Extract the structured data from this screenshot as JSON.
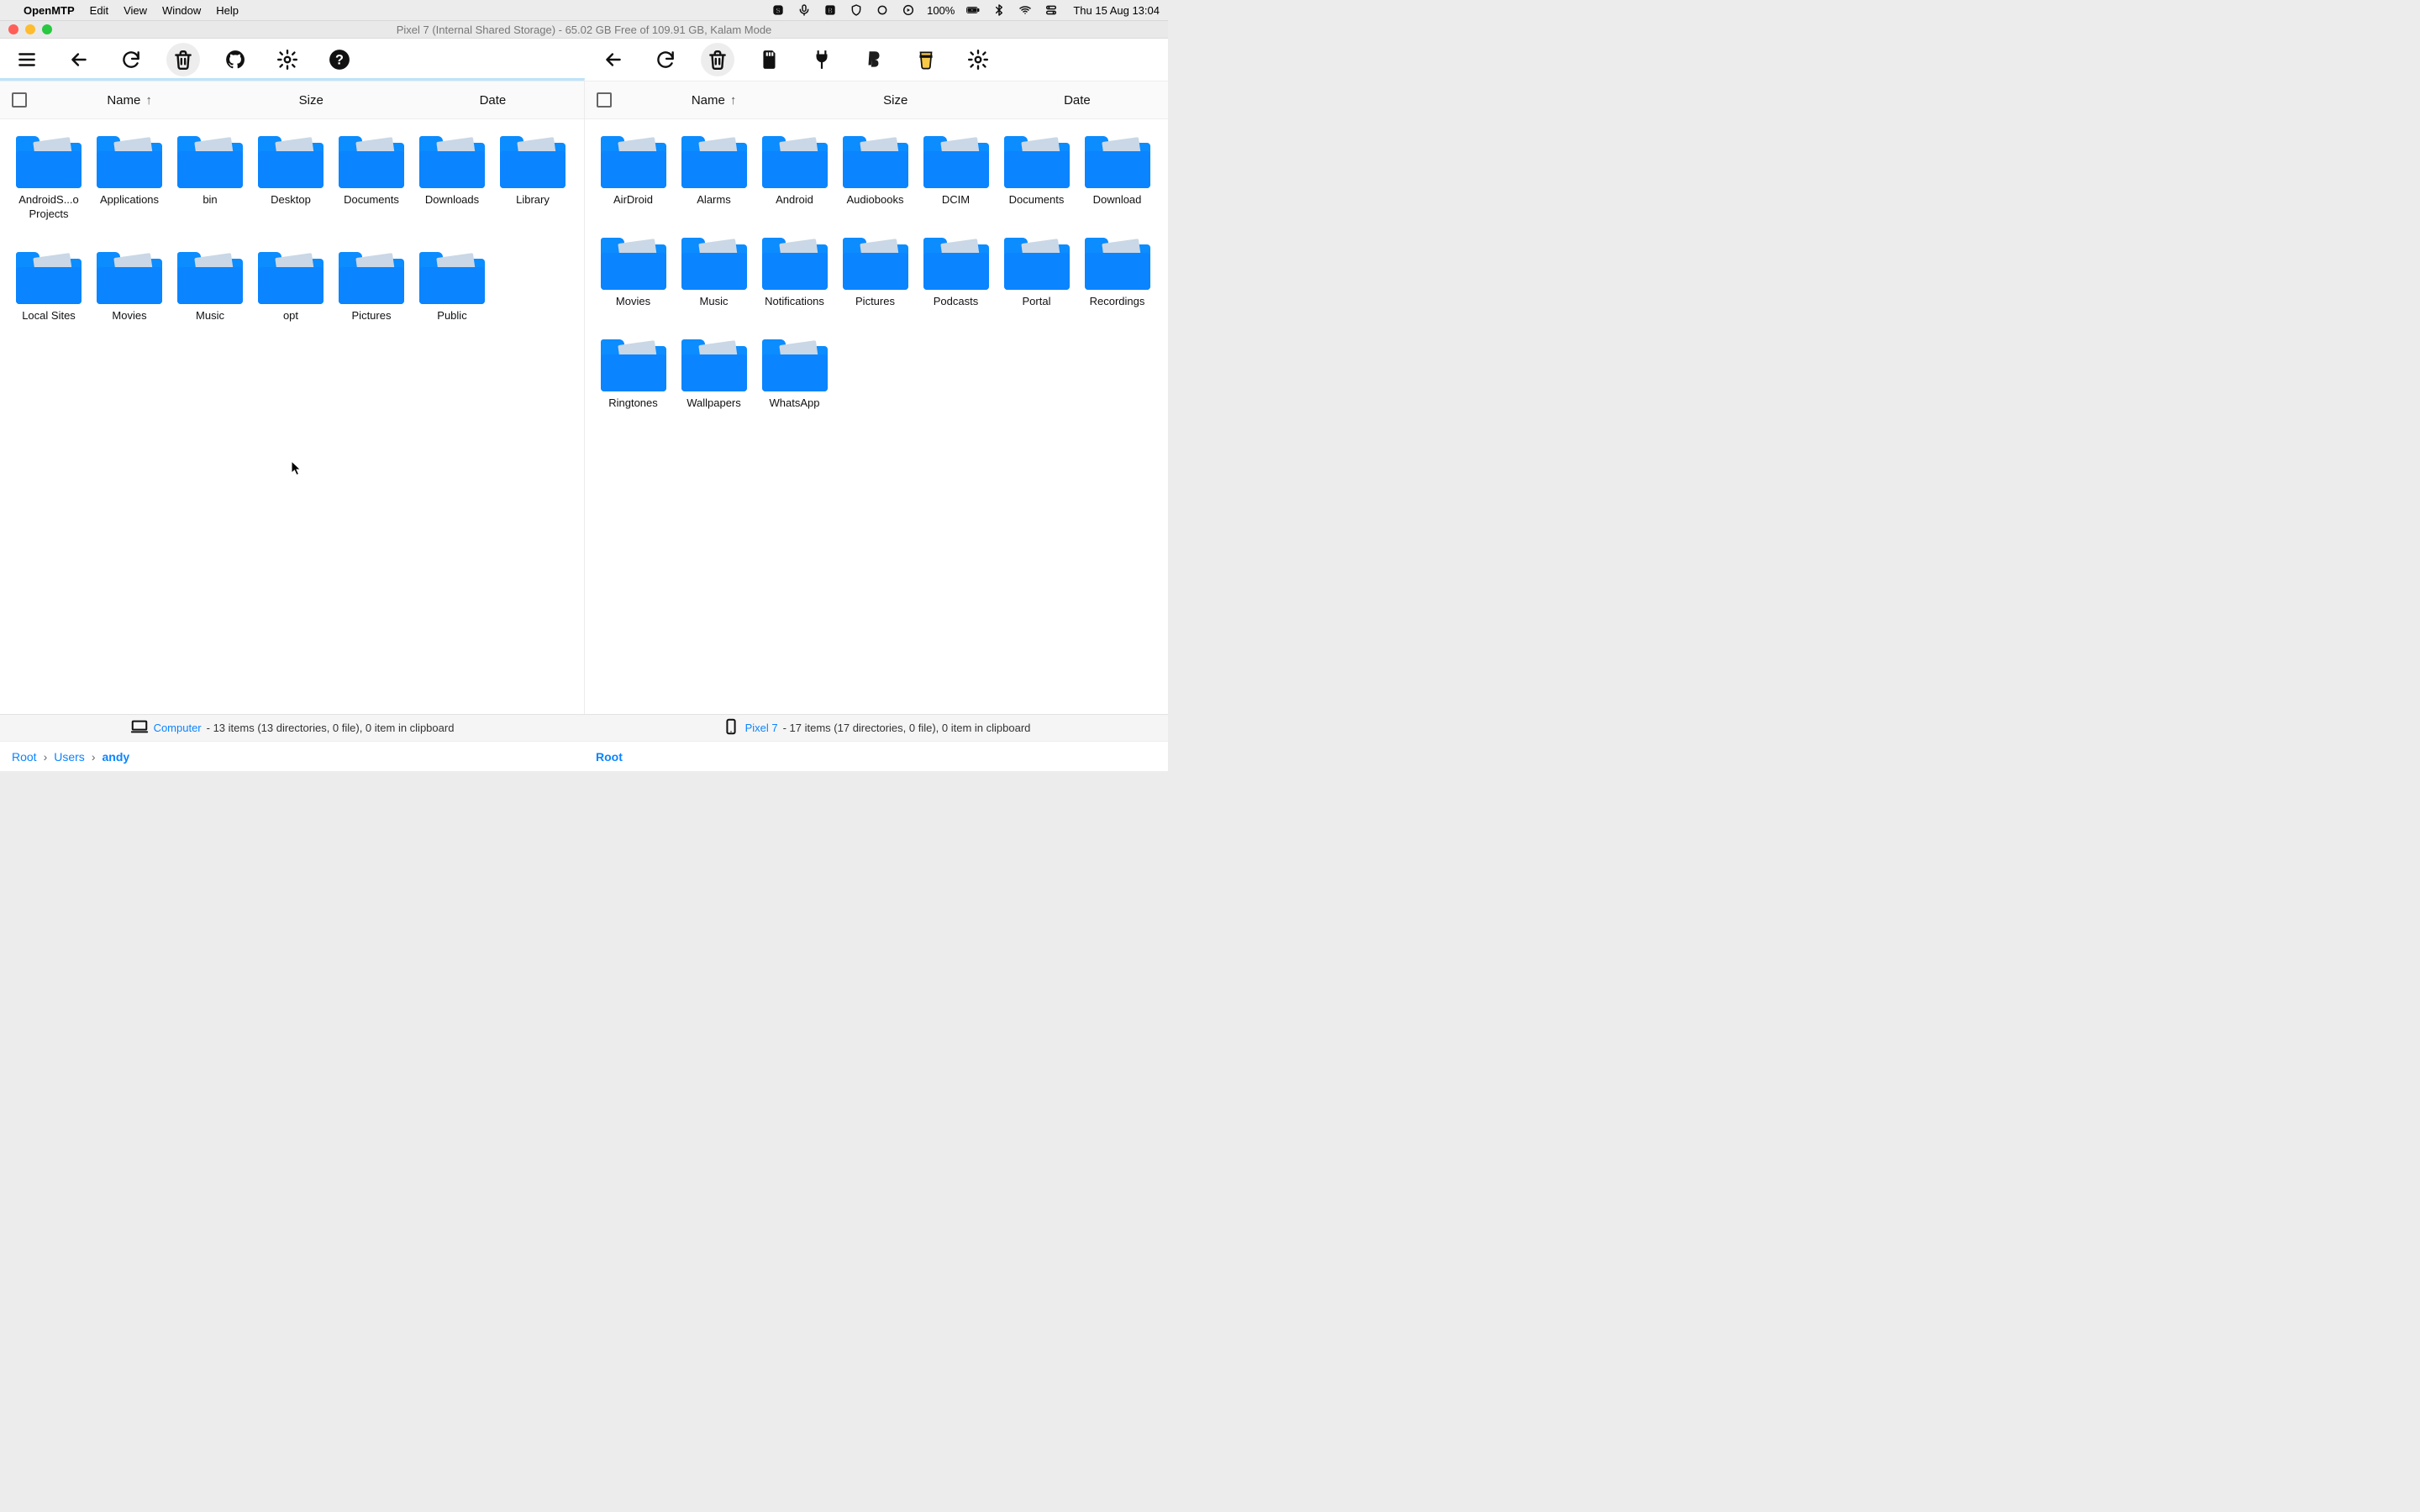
{
  "menubar": {
    "app_name": "OpenMTP",
    "items": [
      "Edit",
      "View",
      "Window",
      "Help"
    ],
    "battery_pct": "100%",
    "datetime": "Thu 15 Aug  13:04"
  },
  "titlebar": {
    "title": "Pixel 7 (Internal Shared Storage) - 65.02 GB Free of 109.91 GB, Kalam Mode"
  },
  "columns": {
    "name": "Name",
    "size": "Size",
    "date": "Date"
  },
  "left_pane": {
    "folders": [
      {
        "label": "AndroidS...o Projects"
      },
      {
        "label": "Applications"
      },
      {
        "label": "bin"
      },
      {
        "label": "Desktop"
      },
      {
        "label": "Documents"
      },
      {
        "label": "Downloads"
      },
      {
        "label": "Library"
      },
      {
        "label": "Local Sites"
      },
      {
        "label": "Movies"
      },
      {
        "label": "Music"
      },
      {
        "label": "opt"
      },
      {
        "label": "Pictures"
      },
      {
        "label": "Public"
      }
    ],
    "status_device": "Computer",
    "status_text": " - 13 items (13 directories, 0 file), 0 item in clipboard",
    "breadcrumb": [
      "Root",
      "Users",
      "andy"
    ]
  },
  "right_pane": {
    "folders": [
      {
        "label": "AirDroid"
      },
      {
        "label": "Alarms"
      },
      {
        "label": "Android"
      },
      {
        "label": "Audiobooks"
      },
      {
        "label": "DCIM"
      },
      {
        "label": "Documents"
      },
      {
        "label": "Download"
      },
      {
        "label": "Movies"
      },
      {
        "label": "Music"
      },
      {
        "label": "Notifications"
      },
      {
        "label": "Pictures"
      },
      {
        "label": "Podcasts"
      },
      {
        "label": "Portal"
      },
      {
        "label": "Recordings"
      },
      {
        "label": "Ringtones"
      },
      {
        "label": "Wallpapers"
      },
      {
        "label": "WhatsApp"
      }
    ],
    "status_device": "Pixel 7",
    "status_text": " - 17 items (17 directories, 0 file), 0 item in clipboard",
    "breadcrumb": [
      "Root"
    ]
  }
}
